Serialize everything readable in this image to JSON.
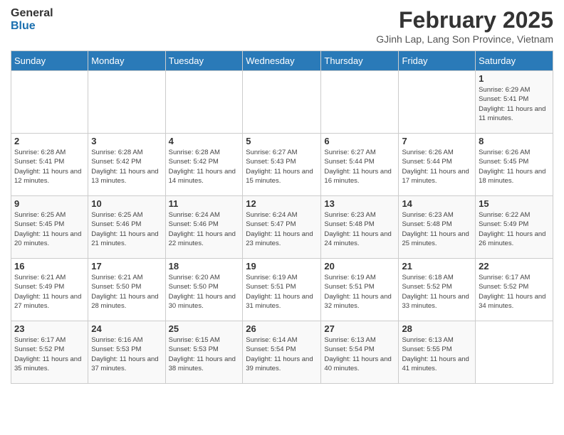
{
  "header": {
    "logo_general": "General",
    "logo_blue": "Blue",
    "main_title": "February 2025",
    "subtitle": "GJinh Lap, Lang Son Province, Vietnam"
  },
  "days_of_week": [
    "Sunday",
    "Monday",
    "Tuesday",
    "Wednesday",
    "Thursday",
    "Friday",
    "Saturday"
  ],
  "weeks": [
    [
      {
        "day": "",
        "info": ""
      },
      {
        "day": "",
        "info": ""
      },
      {
        "day": "",
        "info": ""
      },
      {
        "day": "",
        "info": ""
      },
      {
        "day": "",
        "info": ""
      },
      {
        "day": "",
        "info": ""
      },
      {
        "day": "1",
        "info": "Sunrise: 6:29 AM\nSunset: 5:41 PM\nDaylight: 11 hours and 11 minutes."
      }
    ],
    [
      {
        "day": "2",
        "info": "Sunrise: 6:28 AM\nSunset: 5:41 PM\nDaylight: 11 hours and 12 minutes."
      },
      {
        "day": "3",
        "info": "Sunrise: 6:28 AM\nSunset: 5:42 PM\nDaylight: 11 hours and 13 minutes."
      },
      {
        "day": "4",
        "info": "Sunrise: 6:28 AM\nSunset: 5:42 PM\nDaylight: 11 hours and 14 minutes."
      },
      {
        "day": "5",
        "info": "Sunrise: 6:27 AM\nSunset: 5:43 PM\nDaylight: 11 hours and 15 minutes."
      },
      {
        "day": "6",
        "info": "Sunrise: 6:27 AM\nSunset: 5:44 PM\nDaylight: 11 hours and 16 minutes."
      },
      {
        "day": "7",
        "info": "Sunrise: 6:26 AM\nSunset: 5:44 PM\nDaylight: 11 hours and 17 minutes."
      },
      {
        "day": "8",
        "info": "Sunrise: 6:26 AM\nSunset: 5:45 PM\nDaylight: 11 hours and 18 minutes."
      }
    ],
    [
      {
        "day": "9",
        "info": "Sunrise: 6:25 AM\nSunset: 5:45 PM\nDaylight: 11 hours and 20 minutes."
      },
      {
        "day": "10",
        "info": "Sunrise: 6:25 AM\nSunset: 5:46 PM\nDaylight: 11 hours and 21 minutes."
      },
      {
        "day": "11",
        "info": "Sunrise: 6:24 AM\nSunset: 5:46 PM\nDaylight: 11 hours and 22 minutes."
      },
      {
        "day": "12",
        "info": "Sunrise: 6:24 AM\nSunset: 5:47 PM\nDaylight: 11 hours and 23 minutes."
      },
      {
        "day": "13",
        "info": "Sunrise: 6:23 AM\nSunset: 5:48 PM\nDaylight: 11 hours and 24 minutes."
      },
      {
        "day": "14",
        "info": "Sunrise: 6:23 AM\nSunset: 5:48 PM\nDaylight: 11 hours and 25 minutes."
      },
      {
        "day": "15",
        "info": "Sunrise: 6:22 AM\nSunset: 5:49 PM\nDaylight: 11 hours and 26 minutes."
      }
    ],
    [
      {
        "day": "16",
        "info": "Sunrise: 6:21 AM\nSunset: 5:49 PM\nDaylight: 11 hours and 27 minutes."
      },
      {
        "day": "17",
        "info": "Sunrise: 6:21 AM\nSunset: 5:50 PM\nDaylight: 11 hours and 28 minutes."
      },
      {
        "day": "18",
        "info": "Sunrise: 6:20 AM\nSunset: 5:50 PM\nDaylight: 11 hours and 30 minutes."
      },
      {
        "day": "19",
        "info": "Sunrise: 6:19 AM\nSunset: 5:51 PM\nDaylight: 11 hours and 31 minutes."
      },
      {
        "day": "20",
        "info": "Sunrise: 6:19 AM\nSunset: 5:51 PM\nDaylight: 11 hours and 32 minutes."
      },
      {
        "day": "21",
        "info": "Sunrise: 6:18 AM\nSunset: 5:52 PM\nDaylight: 11 hours and 33 minutes."
      },
      {
        "day": "22",
        "info": "Sunrise: 6:17 AM\nSunset: 5:52 PM\nDaylight: 11 hours and 34 minutes."
      }
    ],
    [
      {
        "day": "23",
        "info": "Sunrise: 6:17 AM\nSunset: 5:52 PM\nDaylight: 11 hours and 35 minutes."
      },
      {
        "day": "24",
        "info": "Sunrise: 6:16 AM\nSunset: 5:53 PM\nDaylight: 11 hours and 37 minutes."
      },
      {
        "day": "25",
        "info": "Sunrise: 6:15 AM\nSunset: 5:53 PM\nDaylight: 11 hours and 38 minutes."
      },
      {
        "day": "26",
        "info": "Sunrise: 6:14 AM\nSunset: 5:54 PM\nDaylight: 11 hours and 39 minutes."
      },
      {
        "day": "27",
        "info": "Sunrise: 6:13 AM\nSunset: 5:54 PM\nDaylight: 11 hours and 40 minutes."
      },
      {
        "day": "28",
        "info": "Sunrise: 6:13 AM\nSunset: 5:55 PM\nDaylight: 11 hours and 41 minutes."
      },
      {
        "day": "",
        "info": ""
      }
    ]
  ]
}
